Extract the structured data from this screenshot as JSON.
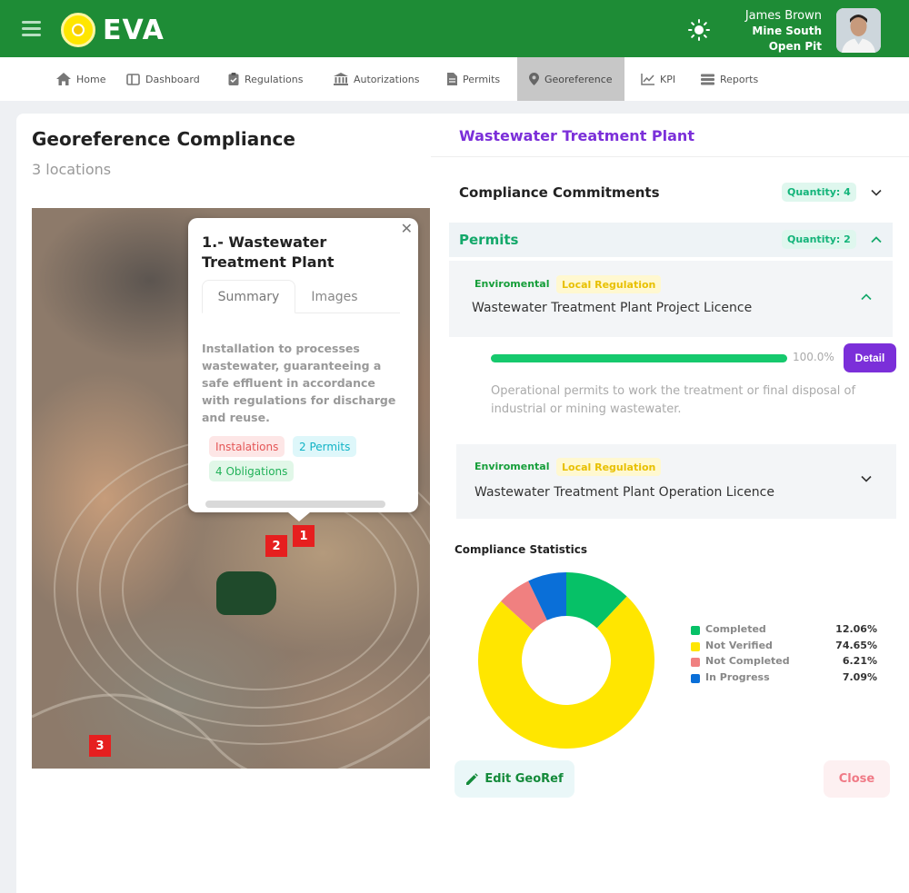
{
  "header": {
    "brand": "EVA",
    "user_name": "James Brown",
    "site": "Mine South",
    "site_type": "Open Pit"
  },
  "nav": [
    {
      "label": "Home",
      "icon": "home-icon"
    },
    {
      "label": "Dashboard",
      "icon": "dashboard-icon"
    },
    {
      "label": "Regulations",
      "icon": "clipboard-icon"
    },
    {
      "label": "Autorizations",
      "icon": "bank-icon"
    },
    {
      "label": "Permits",
      "icon": "document-icon"
    },
    {
      "label": "Georeference",
      "icon": "location-pin-icon",
      "active": true
    },
    {
      "label": "KPI",
      "icon": "line-chart-icon"
    },
    {
      "label": "Reports",
      "icon": "stack-icon"
    }
  ],
  "left": {
    "title": "Georeference Compliance",
    "subtitle": "3 locations",
    "markers": [
      "1",
      "2",
      "3"
    ],
    "popup": {
      "title": "1.- Wastewater Treatment Plant",
      "tabs": [
        "Summary",
        "Images"
      ],
      "description": "Installation to processes wastewater, guaranteeing a safe effluent in accordance with regulations for discharge and reuse.",
      "chips": [
        "Instalations",
        "2 Permits",
        "4 Obligations"
      ]
    }
  },
  "right": {
    "title": "Wastewater Treatment Plant",
    "commitments": {
      "label": "Compliance Commitments",
      "quantity": "Quantity: 4"
    },
    "permits": {
      "label": "Permits",
      "quantity": "Quantity: 2",
      "items": [
        {
          "category": "Enviromental",
          "regulation": "Local Regulation",
          "name": "Wastewater Treatment Plant Project Licence",
          "progress": 100,
          "progress_label": "100.0%",
          "detail_label": "Detail",
          "description": "Operational permits to work the treatment or final disposal of industrial or mining wastewater."
        },
        {
          "category": "Enviromental",
          "regulation": "Local Regulation",
          "name": "Wastewater Treatment Plant Operation Licence"
        }
      ]
    },
    "stats": {
      "title": "Compliance Statistics",
      "legend": [
        {
          "label": "Completed",
          "value": "12.06%",
          "color": "#06c167"
        },
        {
          "label": "Not Verified",
          "value": "74.65%",
          "color": "#ffe600"
        },
        {
          "label": "Not Completed",
          "value": "6.21%",
          "color": "#f08080"
        },
        {
          "label": "In Progress",
          "value": "7.09%",
          "color": "#0a6fd8"
        }
      ]
    },
    "actions": {
      "edit": "Edit GeoRef",
      "close": "Close"
    }
  },
  "chart_data": {
    "type": "pie",
    "donut": true,
    "categories": [
      "Completed",
      "Not Verified",
      "Not Completed",
      "In Progress"
    ],
    "values": [
      12.06,
      74.65,
      6.21,
      7.09
    ],
    "colors": [
      "#06c167",
      "#ffe600",
      "#f08080",
      "#0a6fd8"
    ],
    "title": "Compliance Statistics",
    "legend": "right"
  }
}
